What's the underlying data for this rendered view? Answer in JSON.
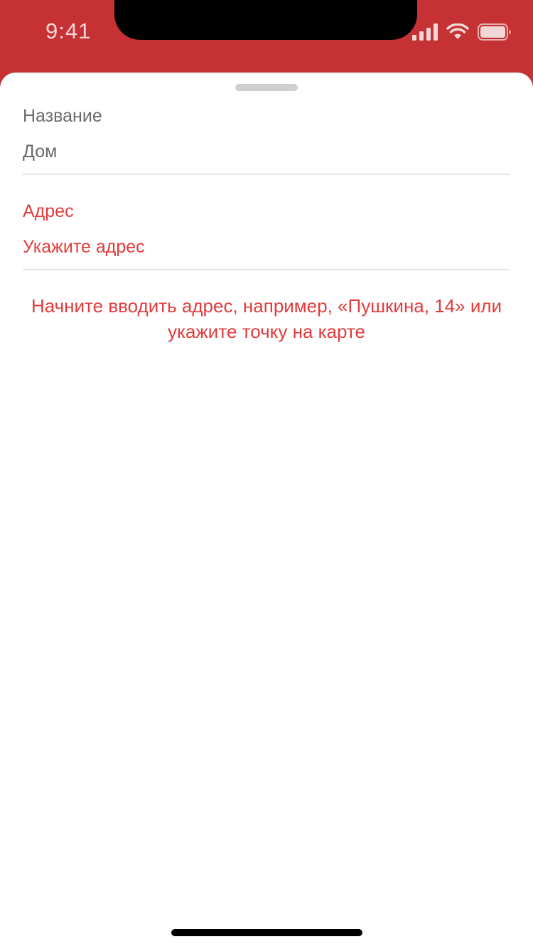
{
  "status_bar": {
    "time": "9:41",
    "icons": [
      "signal-icon",
      "wifi-icon",
      "battery-icon"
    ]
  },
  "colors": {
    "header_bg": "#C63233",
    "error_text": "#E23B3B",
    "label_text": "#6B6B6B",
    "divider": "#E6E6E6"
  },
  "form": {
    "name_field": {
      "label": "Название",
      "value": "Дом"
    },
    "address_field": {
      "label": "Адрес",
      "placeholder": "Укажите адрес"
    },
    "hint": "Начните вводить адрес, например, «Пушкина, 14» или укажите точку на карте"
  }
}
